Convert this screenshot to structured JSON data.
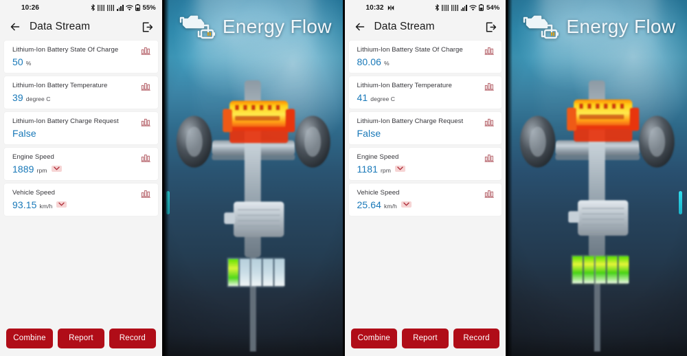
{
  "devices": [
    {
      "id": "device-1",
      "statusbar": {
        "time": "10:26",
        "battery_percent": "55%",
        "icons": [
          "bluetooth-icon",
          "nfc-icon",
          "vpn-icon",
          "signal-bars-icon",
          "wifi-icon",
          "battery-icon"
        ]
      },
      "header": {
        "back_icon": "back-arrow-icon",
        "title": "Data Stream",
        "exit_icon": "exit-icon"
      },
      "rows": [
        {
          "label": "Lithium-Ion Battery State Of Charge",
          "value": "50",
          "unit": "%",
          "has_dropdown": false,
          "chart_icon": "bar-chart-icon"
        },
        {
          "label": "Lithium-Ion Battery Temperature",
          "value": "39",
          "unit": "degree C",
          "has_dropdown": false,
          "chart_icon": "bar-chart-icon"
        },
        {
          "label": "Lithium-Ion Battery Charge Request",
          "value": "False",
          "unit": "",
          "has_dropdown": false,
          "chart_icon": "bar-chart-icon"
        },
        {
          "label": "Engine Speed",
          "value": "1889",
          "unit": "rpm",
          "has_dropdown": true,
          "chart_icon": "bar-chart-icon"
        },
        {
          "label": "Vehicle Speed",
          "value": "93.15",
          "unit": "km/h",
          "has_dropdown": true,
          "chart_icon": "bar-chart-icon"
        }
      ],
      "buttons": [
        {
          "label": "Combine",
          "name": "combine-button"
        },
        {
          "label": "Report",
          "name": "report-button"
        },
        {
          "label": "Record",
          "name": "record-button"
        }
      ]
    },
    {
      "id": "device-2",
      "statusbar": {
        "time": "10:32",
        "battery_percent": "54%",
        "icons": [
          "mute-icon",
          "bluetooth-icon",
          "nfc-icon",
          "vpn-icon",
          "signal-bars-icon",
          "wifi-icon",
          "battery-icon"
        ]
      },
      "header": {
        "back_icon": "back-arrow-icon",
        "title": "Data Stream",
        "exit_icon": "exit-icon"
      },
      "rows": [
        {
          "label": "Lithium-Ion Battery State Of Charge",
          "value": "80.06",
          "unit": "%",
          "has_dropdown": false,
          "chart_icon": "bar-chart-icon"
        },
        {
          "label": "Lithium-Ion Battery Temperature",
          "value": "41",
          "unit": "degree C",
          "has_dropdown": false,
          "chart_icon": "bar-chart-icon"
        },
        {
          "label": "Lithium-Ion Battery Charge Request",
          "value": "False",
          "unit": "",
          "has_dropdown": false,
          "chart_icon": "bar-chart-icon"
        },
        {
          "label": "Engine Speed",
          "value": "1181",
          "unit": "rpm",
          "has_dropdown": true,
          "chart_icon": "bar-chart-icon"
        },
        {
          "label": "Vehicle Speed",
          "value": "25.64",
          "unit": "km/h",
          "has_dropdown": true,
          "chart_icon": "bar-chart-icon"
        }
      ],
      "buttons": [
        {
          "label": "Combine",
          "name": "combine-button"
        },
        {
          "label": "Report",
          "name": "report-button"
        },
        {
          "label": "Record",
          "name": "record-button"
        }
      ]
    }
  ],
  "energy_flow_panels": [
    {
      "id": "energy-flow-1",
      "title": "Energy Flow",
      "title_icon": "engine-battery-icon",
      "battery_cells_total": 5,
      "battery_cells_charged": 1,
      "engine_state": "hot",
      "scroll_indicator": "teal-scroll-pill"
    },
    {
      "id": "energy-flow-2",
      "title": "Energy Flow",
      "title_icon": "engine-battery-icon",
      "battery_cells_total": 5,
      "battery_cells_charged": 5,
      "engine_state": "hot",
      "scroll_indicator": "cyan-scroll-pill"
    }
  ],
  "colors": {
    "button_red": "#b00d18",
    "value_blue": "#1878b8",
    "chart_icon_red": "#b5626a",
    "chevron_bg": "#f6d4d4",
    "list_bg": "#f4f4f4",
    "card_bg": "#ffffff"
  }
}
